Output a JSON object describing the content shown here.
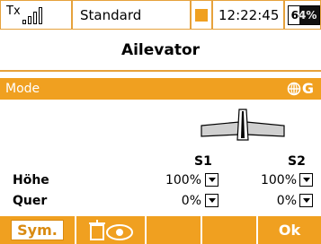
{
  "status": {
    "tx_label": "Tx",
    "signal_bars": 4,
    "profile": "Standard",
    "time": "12:22:45",
    "battery": "64%",
    "battery_level": 0.64
  },
  "title": "Ailevator",
  "mode": {
    "label": "Mode",
    "value": "G"
  },
  "table": {
    "columns": [
      "S1",
      "S2"
    ],
    "rows": [
      {
        "label": "Höhe",
        "s1": "100%",
        "s2": "100%"
      },
      {
        "label": "Quer",
        "s1": "0%",
        "s2": "0%"
      }
    ]
  },
  "footer": {
    "sym": "Sym.",
    "ok": "Ok"
  },
  "colors": {
    "accent": "#f0a020",
    "line": "#e6a23c"
  }
}
